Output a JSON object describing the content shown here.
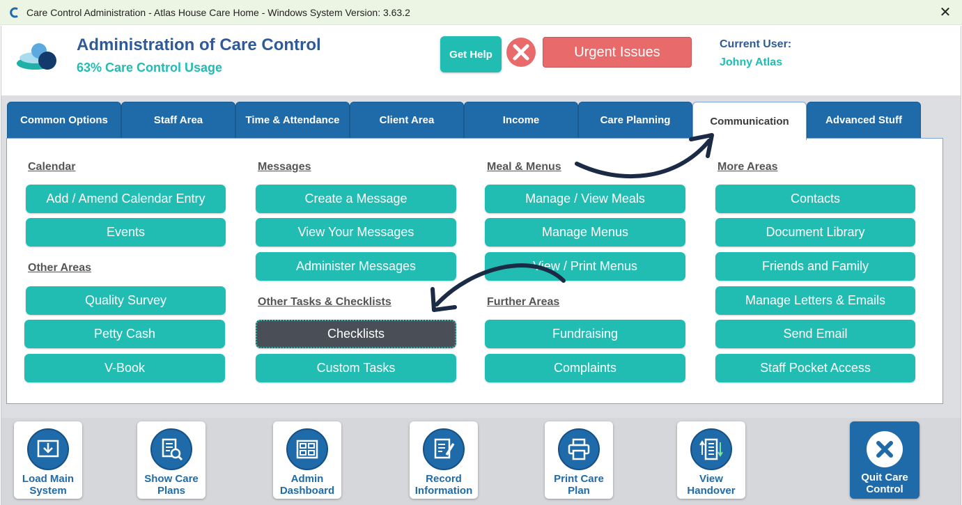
{
  "window": {
    "title": "Care Control Administration - Atlas House Care Home - Windows System Version: 3.63.2"
  },
  "header": {
    "title": "Administration of Care Control",
    "usage": "63% Care Control Usage",
    "get_help": "Get Help",
    "urgent_issues": "Urgent Issues",
    "current_user_label": "Current User:",
    "current_user_name": "Johny Atlas"
  },
  "tabs": [
    {
      "label": "Common Options"
    },
    {
      "label": "Staff Area"
    },
    {
      "label": "Time & Attendance"
    },
    {
      "label": "Client Area"
    },
    {
      "label": "Income"
    },
    {
      "label": "Care Planning"
    },
    {
      "label": "Communication",
      "active": true
    },
    {
      "label": "Advanced Stuff"
    }
  ],
  "sections": {
    "calendar": {
      "heading": "Calendar",
      "items": [
        "Add / Amend Calendar Entry",
        "Events"
      ]
    },
    "other_areas": {
      "heading": "Other Areas",
      "items": [
        "Quality Survey",
        "Petty Cash",
        "V-Book"
      ]
    },
    "messages": {
      "heading": "Messages",
      "items": [
        "Create a Message",
        "View Your Messages",
        "Administer Messages"
      ]
    },
    "other_tasks": {
      "heading": "Other Tasks & Checklists",
      "items": [
        "Checklists",
        "Custom Tasks"
      ]
    },
    "meals": {
      "heading": "Meal & Menus",
      "items": [
        "Manage / View Meals",
        "Manage Menus",
        "View / Print Menus"
      ]
    },
    "further_areas": {
      "heading": "Further Areas",
      "items": [
        "Fundraising",
        "Complaints"
      ]
    },
    "more_areas": {
      "heading": "More Areas",
      "items": [
        "Contacts",
        "Document Library",
        "Friends and Family",
        "Manage Letters & Emails",
        "Send Email",
        "Staff Pocket Access"
      ]
    }
  },
  "bottom": {
    "load_main": "Load Main System",
    "show_care_plans": "Show Care Plans",
    "admin_dashboard": "Admin Dashboard",
    "record_information": "Record Information",
    "print_care_plan": "Print Care Plan",
    "view_handover": "View Handover",
    "quit": "Quit Care Control"
  },
  "colors": {
    "teal": "#21bdb3",
    "blue": "#1f6aa8",
    "title_blue": "#2d5a9a",
    "urgent_red": "#e86a6a",
    "selected_dark": "#4a4f57"
  }
}
